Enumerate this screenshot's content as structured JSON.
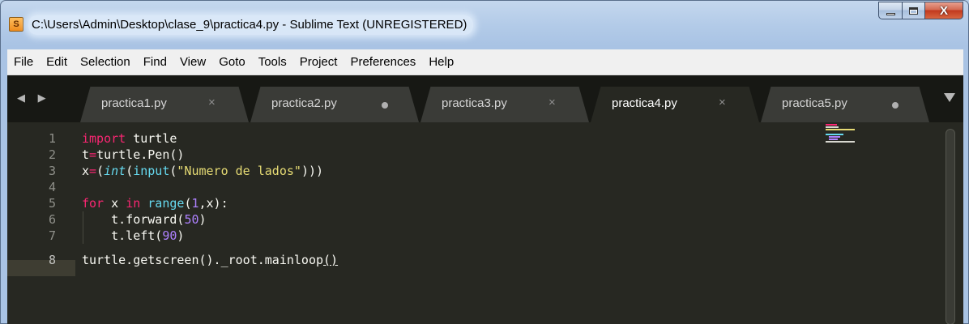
{
  "window": {
    "title": "C:\\Users\\Admin\\Desktop\\clase_9\\practica4.py - Sublime Text (UNREGISTERED)",
    "app_icon_letter": "S",
    "close_symbol": "X"
  },
  "menu": {
    "items": [
      "File",
      "Edit",
      "Selection",
      "Find",
      "View",
      "Goto",
      "Tools",
      "Project",
      "Preferences",
      "Help"
    ]
  },
  "tabs": [
    {
      "label": "practica1.py",
      "state": "close",
      "active": false
    },
    {
      "label": "practica2.py",
      "state": "dirty",
      "active": false
    },
    {
      "label": "practica3.py",
      "state": "close",
      "active": false
    },
    {
      "label": "practica4.py",
      "state": "close",
      "active": true
    },
    {
      "label": "practica5.py",
      "state": "dirty",
      "active": false
    }
  ],
  "tab_symbols": {
    "close": "×",
    "nav": "◀ ▶"
  },
  "editor": {
    "current_line": 8,
    "line_numbers": [
      "1",
      "2",
      "3",
      "4",
      "5",
      "6",
      "7",
      "8"
    ],
    "lines": [
      "import turtle",
      "t=turtle.Pen()",
      "x=(int(input(\"Numero de lados\")))",
      "",
      "for x in range(1,x):",
      "    t.forward(50)",
      "    t.left(90)",
      "turtle.getscreen()._root.mainloop()"
    ]
  },
  "colors": {
    "editor_bg": "#272822",
    "keyword": "#f92672",
    "builtin": "#66d9ef",
    "string": "#e6db74",
    "number": "#ae81ff",
    "text": "#f8f8f2",
    "gutter_text": "#8f908a"
  }
}
